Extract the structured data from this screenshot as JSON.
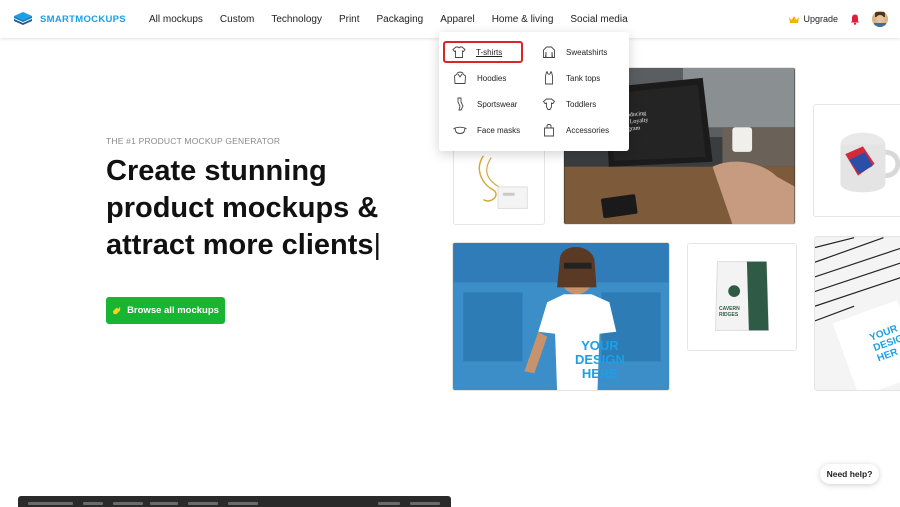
{
  "brand": {
    "name": "SMARTMOCKUPS",
    "color": "#1aa0e6"
  },
  "nav": {
    "items": [
      {
        "label": "All mockups"
      },
      {
        "label": "Custom"
      },
      {
        "label": "Technology"
      },
      {
        "label": "Print"
      },
      {
        "label": "Packaging"
      },
      {
        "label": "Apparel"
      },
      {
        "label": "Home & living"
      },
      {
        "label": "Social media"
      }
    ]
  },
  "header_right": {
    "upgrade_label": "Upgrade",
    "icons": [
      "crown-icon",
      "notification-bell-icon",
      "user-avatar"
    ]
  },
  "dropdown": {
    "left_column": [
      {
        "label": "T-shirts",
        "icon": "tshirt-icon",
        "highlighted": true
      },
      {
        "label": "Hoodies",
        "icon": "hoodie-icon"
      },
      {
        "label": "Sportswear",
        "icon": "sportswear-icon"
      },
      {
        "label": "Face masks",
        "icon": "face-mask-icon"
      }
    ],
    "right_column": [
      {
        "label": "Sweatshirts",
        "icon": "sweatshirt-icon"
      },
      {
        "label": "Tank tops",
        "icon": "tank-top-icon"
      },
      {
        "label": "Toddlers",
        "icon": "toddler-icon"
      },
      {
        "label": "Accessories",
        "icon": "accessories-icon"
      }
    ]
  },
  "hero": {
    "kicker": "THE #1 PRODUCT MOCKUP GENERATOR",
    "headline_lines": [
      "Create stunning",
      "product mockups &",
      "attract more clients"
    ],
    "caret": "|",
    "cta_label": "Browse all mockups"
  },
  "mockups": {
    "laptop_screen_text": [
      "Introducing",
      "Our Loyalty",
      "Program"
    ],
    "tshirt_text": [
      "YOUR",
      "DESIGN",
      "HERE"
    ],
    "coffee_bag_text": [
      "CAVERN",
      "RIDGES"
    ],
    "card_text": [
      "YOUR",
      "DESIG",
      "HER"
    ]
  },
  "help": {
    "label": "Need help?"
  },
  "colors": {
    "cta": "#18b533",
    "highlight_outline": "#d8262a",
    "design_text": "#1aa0e6"
  }
}
